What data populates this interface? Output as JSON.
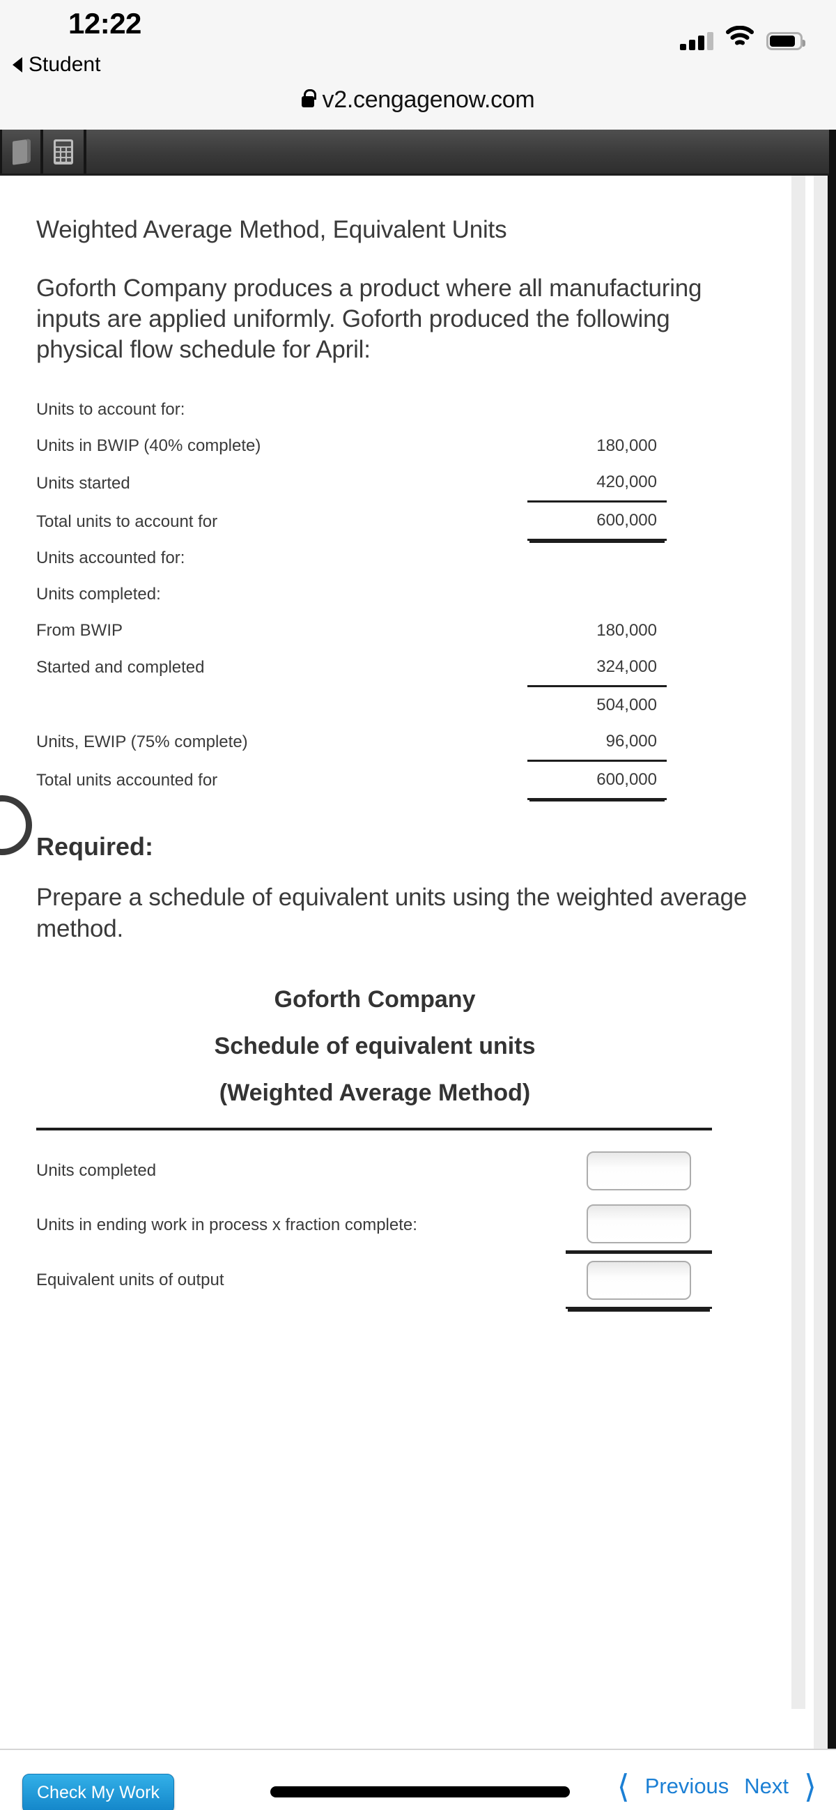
{
  "status_bar": {
    "time": "12:22",
    "signal_icon": "signal-bars-icon",
    "wifi_icon": "wifi-icon",
    "battery_icon": "battery-icon"
  },
  "back_to_app": {
    "label": "Student",
    "icon": "back-triangle-icon"
  },
  "url_bar": {
    "lock_icon": "lock-icon",
    "url": "v2.cengagenow.com"
  },
  "app_toolbar": {
    "items": [
      {
        "icon": "ebook-icon"
      },
      {
        "icon": "calculator-icon"
      }
    ]
  },
  "problem": {
    "title": "Weighted Average Method, Equivalent Units",
    "body": "Goforth Company produces a product where all manufacturing inputs are applied uniformly. Goforth produced the following physical flow schedule for April:"
  },
  "flow_schedule": {
    "rows": [
      {
        "label": "Units to account for:",
        "value": "",
        "indent": false,
        "rule": "none"
      },
      {
        "label": "Units in BWIP (40% complete)",
        "value": "180,000",
        "indent": false,
        "rule": "none"
      },
      {
        "label": "Units started",
        "value": "420,000",
        "indent": false,
        "rule": "single"
      },
      {
        "label": "Total units to account for",
        "value": "600,000",
        "indent": true,
        "rule": "double"
      },
      {
        "label": "Units accounted for:",
        "value": "",
        "indent": false,
        "rule": "none"
      },
      {
        "label": "Units completed:",
        "value": "",
        "indent": false,
        "rule": "none"
      },
      {
        "label": "From BWIP",
        "value": "180,000",
        "indent": false,
        "rule": "none"
      },
      {
        "label": "Started and completed",
        "value": "324,000",
        "indent": false,
        "rule": "single"
      },
      {
        "label": "",
        "value": "504,000",
        "indent": false,
        "rule": "none"
      },
      {
        "label": "Units, EWIP (75% complete)",
        "value": "96,000",
        "indent": false,
        "rule": "single"
      },
      {
        "label": "Total units accounted for",
        "value": "600,000",
        "indent": false,
        "rule": "double"
      }
    ]
  },
  "required": {
    "heading": "Required:",
    "text": "Prepare a schedule of equivalent units using the weighted average method."
  },
  "answer_schedule": {
    "title_line1": "Goforth Company",
    "title_line2": "Schedule of equivalent units",
    "title_line3": "(Weighted Average Method)",
    "rows": [
      {
        "label": "Units completed",
        "value": "",
        "rule": "none"
      },
      {
        "label": "Units in ending work in process x fraction complete:",
        "value": "",
        "rule": "single"
      },
      {
        "label": "Equivalent units of output",
        "value": "",
        "rule": "double"
      }
    ]
  },
  "bottom_bar": {
    "check_my_work": "Check My Work",
    "previous": "Previous",
    "next": "Next",
    "prev_icon": "chevron-left-icon",
    "next_icon": "chevron-right-icon",
    "home_indicator": "home-indicator"
  },
  "colors": {
    "accent_blue": "#1b7fd4",
    "button_blue_top": "#33b0e8",
    "button_blue_bottom": "#1284c8",
    "toolbar_dark": "#3a3a3a",
    "text": "#3a3a3a"
  }
}
